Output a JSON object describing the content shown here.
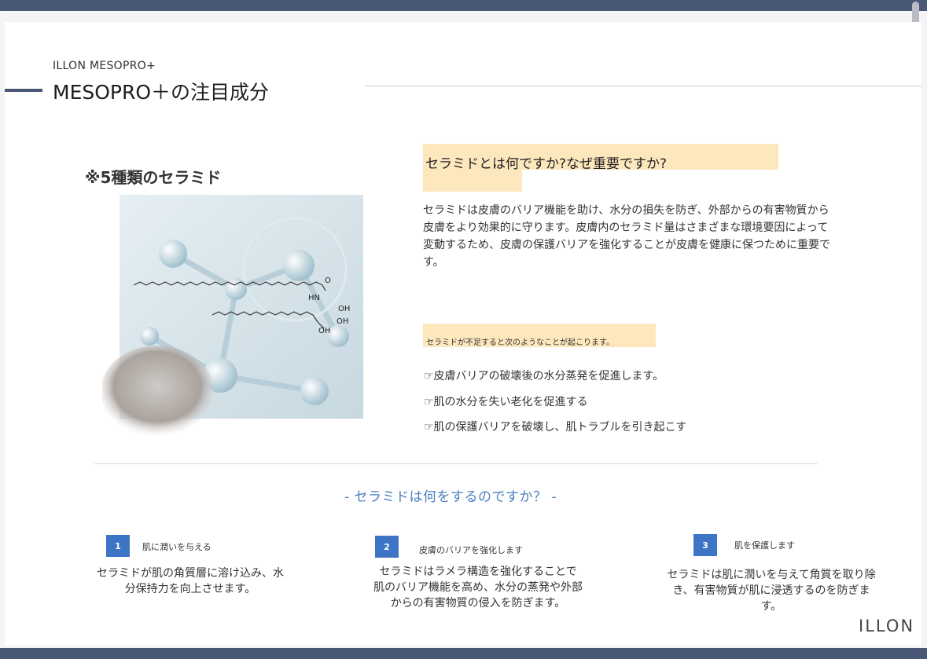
{
  "header": {
    "brand_sub": "ILLON MESOPRO+",
    "title": "MESOPRO＋の注目成分"
  },
  "left": {
    "heading": "※5種類のセラミド",
    "illustration_labels": [
      "O",
      "HN",
      "OH",
      "OH",
      "OH"
    ]
  },
  "right": {
    "question": "セラミドとは何ですか?なぜ重要ですか?",
    "paragraph": "セラミドは皮膚のバリア機能を助け、水分の損失を防ぎ、外部からの有害物質から皮膚をより効果的に守ります。皮膚内のセラミド量はさまざまな環境要因によって変動するため、皮膚の保護バリアを強化することが皮膚を健康に保つために重要です。",
    "note": "セラミドが不足すると次のようなことが起こります。",
    "bullets": [
      "☞皮膚バリアの破壊後の水分蒸発を促進します。",
      "☞肌の水分を失い老化を促進する",
      "☞肌の保護バリアを破壊し、肌トラブルを引き起こす"
    ]
  },
  "section": {
    "heading": "- セラミドは何をするのですか？ -",
    "items": [
      {
        "number": "1",
        "label": "肌に潤いを与える",
        "body": [
          "セラミドが肌の角質層に溶け込み、水",
          "分保持力を向上させます。"
        ]
      },
      {
        "number": "2",
        "label": "皮膚のバリアを強化します",
        "body": [
          "セラミドはラメラ構造を強化することで",
          "肌のバリア機能を高め、水分の蒸発や外部",
          "からの有害物質の侵入を防ぎます。"
        ]
      },
      {
        "number": "3",
        "label": "肌を保護します",
        "body": [
          "セラミドは肌に潤いを与えて角質を取り除",
          "き、有害物質が肌に浸透するのを防ぎま",
          "す。"
        ]
      }
    ]
  },
  "footer": {
    "logo": "ILLON"
  },
  "colors": {
    "frame_bar": "#4a5877",
    "highlight": "#fde7bd",
    "accent_blue": "#3d74c5",
    "subheading_blue": "#4a7fc1"
  }
}
